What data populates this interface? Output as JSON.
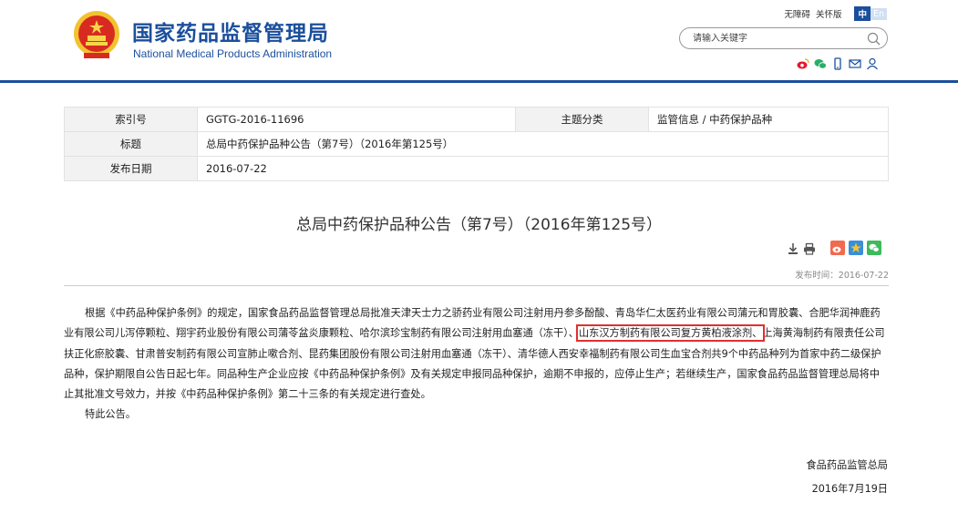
{
  "header": {
    "site_name_cn": "国家药品监督管理局",
    "site_name_en": "National Medical Products Administration",
    "accessibility_link": "无障碍",
    "care_mode_link": "关怀版",
    "lang_zh": "中",
    "lang_en": "En",
    "search_placeholder": "请输入关键字",
    "brand_color": "#1b4f9c"
  },
  "meta": {
    "index_label": "索引号",
    "index_value": "GGTG-2016-11696",
    "category_label": "主题分类",
    "category_value": "监管信息 / 中药保护品种",
    "title_label": "标题",
    "title_value": "总局中药保护品种公告（第7号）（2016年第125号）",
    "date_label": "发布日期",
    "date_value": "2016-07-22"
  },
  "article": {
    "title": "总局中药保护品种公告（第7号）（2016年第125号）",
    "publish_time": "发布时间：2016-07-22",
    "para1_a": "根据《中药品种保护条例》的规定，国家食品药品监督管理总局批准天津天士力之骄药业有限公司注射用丹参多酚酸、青岛华仁太医药业有限公司蒲元和胃胶囊、合肥华润神鹿药业有限公司儿泻停颗粒、翔宇药业股份有限公司蒲苓盆炎康颗粒、哈尔滨珍宝制药有限公司注射用血塞通（冻干）、",
    "para1_highlight": "山东汉方制药有限公司复方黄柏液涂剂、",
    "para1_b": "上海黄海制药有限责任公司扶正化瘀胶囊、甘肃普安制药有限公司宣肺止嗽合剂、昆药集团股份有限公司注射用血塞通（冻干）、清华德人西安幸福制药有限公司生血宝合剂共9个中药品种列为首家中药二级保护品种，保护期限自公告日起七年。同品种生产企业应按《中药品种保护条例》及有关规定申报同品种保护，逾期不申报的，应停止生产；若继续生产，国家食品药品监督管理总局将中止其批准文号效力，并按《中药品种保护条例》第二十三条的有关规定进行查处。",
    "para2": "特此公告。",
    "signature_org": "食品药品监管总局",
    "signature_date": "2016年7月19日",
    "highlight_color": "#e03030"
  }
}
